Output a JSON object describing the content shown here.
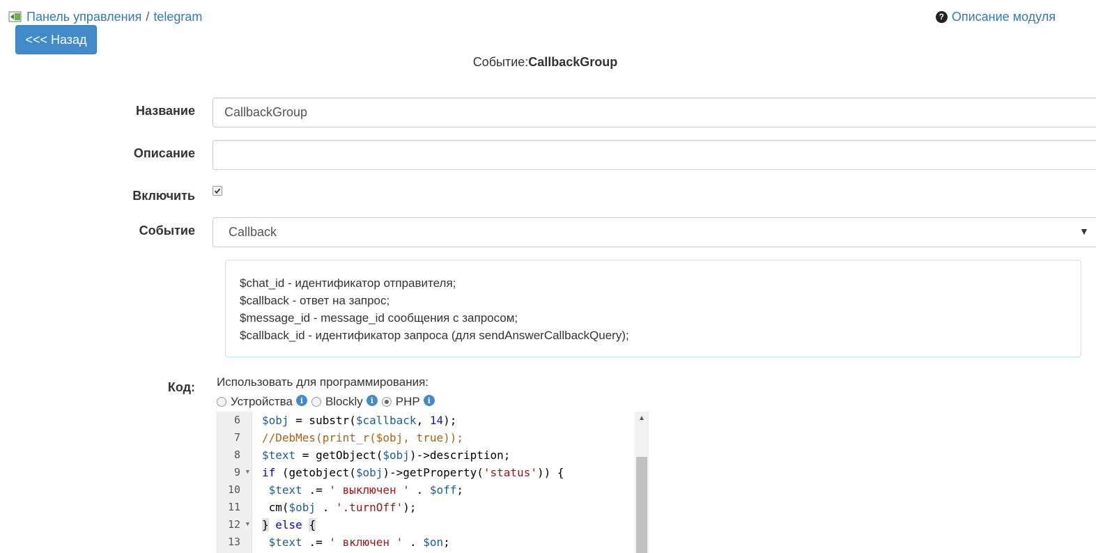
{
  "breadcrumb": {
    "panel": "Панель управления",
    "sep": "/",
    "module": "telegram"
  },
  "module_description_link": "Описание модуля",
  "back_button": "<<< Назад",
  "title": {
    "prefix": "Событие:",
    "name": "CallbackGroup"
  },
  "form": {
    "name_label": "Название",
    "name_value": "CallbackGroup",
    "description_label": "Описание",
    "description_value": "",
    "enable_label": "Включить",
    "enable_checked": true,
    "event_label": "Событие",
    "event_value": "Callback",
    "help_lines": [
      "$chat_id - идентификатор отправителя;",
      "$callback - ответ на запрос;",
      "$message_id - message_id сообщения с запросом;",
      "$callback_id - идентификатор запроса (для sendAnswerCallbackQuery);"
    ],
    "code_label": "Код:",
    "use_for_programming": "Использовать для программирования:",
    "options": {
      "devices": "Устройства",
      "blockly": "Blockly",
      "php": "PHP"
    },
    "selected_option": "PHP"
  },
  "editor": {
    "line_numbers": [
      "6",
      "7",
      "8",
      "9",
      "10",
      "11",
      "12",
      "13"
    ],
    "fold_lines": [
      "9",
      "12"
    ]
  }
}
